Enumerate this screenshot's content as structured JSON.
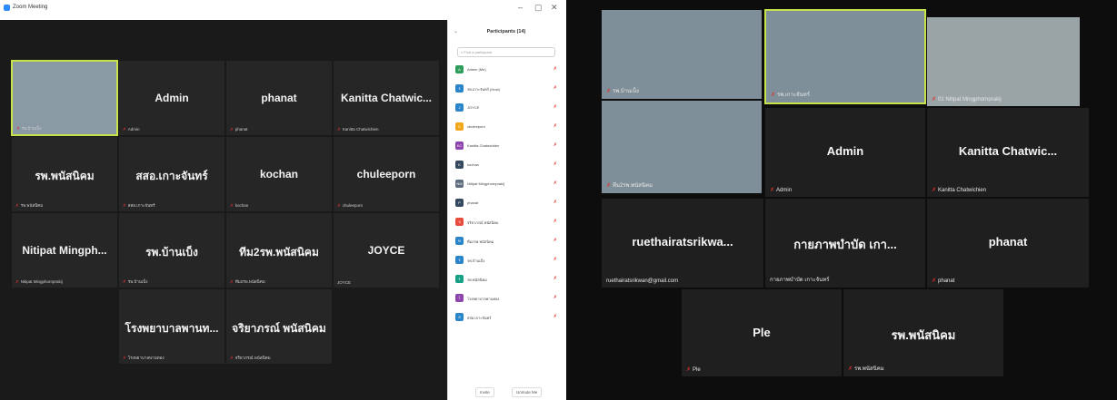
{
  "left_window": {
    "title": "Zoom Meeting",
    "window_controls": [
      "–",
      "▢",
      "✕"
    ],
    "gallery": [
      {
        "name": "",
        "sub": "รพ.บ้านเบ็ง",
        "video": true
      },
      {
        "name": "Admin",
        "sub": "Admin"
      },
      {
        "name": "phanat",
        "sub": "phanat"
      },
      {
        "name": "Kanitta Chatwic...",
        "sub": "Kanitta Chatwichien"
      },
      {
        "name": "รพ.พนัสนิคม",
        "sub": "รพ.พนัสนิคม"
      },
      {
        "name": "สสอ.เกาะจันทร์",
        "sub": "สสอ.เกาะจันทร์"
      },
      {
        "name": "kochan",
        "sub": "kochan"
      },
      {
        "name": "chuleeporn",
        "sub": "chuleeporn"
      },
      {
        "name": "Nitipat Mingph...",
        "sub": "Nitipat Mingphornprakij"
      },
      {
        "name": "รพ.บ้านเบ็ง",
        "sub": "รพ.บ้านเบ็ง"
      },
      {
        "name": "ทีม2รพ.พนัสนิคม",
        "sub": "ทีม2รพ.พนัสนิคม"
      },
      {
        "name": "JOYCE",
        "sub": "JOYCE"
      },
      {
        "name": "โรงพยาบาลพานท...",
        "sub": "โรงพยาบาลพานทอง"
      },
      {
        "name": "จริยาภรณ์ พนัสนิคม",
        "sub": "จริยาภรณ์ พนัสนิคม"
      }
    ],
    "participants_panel": {
      "title": "Participants (14)",
      "search_placeholder": "Find a participant",
      "participants": [
        {
          "initial": "A",
          "name": "Admin (Me)",
          "color": "#2e9d5b"
        },
        {
          "initial": "ร",
          "name": "รพ.เกาะจันทร์ (Host)",
          "color": "#2b86c9"
        },
        {
          "initial": "J",
          "name": "JOYCE",
          "color": "#2b86c9"
        },
        {
          "initial": "C",
          "name": "chuleeporn",
          "color": "#f2a71b"
        },
        {
          "initial": "KC",
          "name": "Kanitta Chatwichien",
          "color": "#8e44ad"
        },
        {
          "initial": "K",
          "name": "kochan",
          "color": "#34495e"
        },
        {
          "initial": "NM",
          "name": "Nitipat Mingphornprakij",
          "color": "#5d6d7e"
        },
        {
          "initial": "P",
          "name": "phanat",
          "color": "#34495e"
        },
        {
          "initial": "จ",
          "name": "จริยาภรณ์ พนัสนิคม",
          "color": "#e74c3c"
        },
        {
          "initial": "ท",
          "name": "ทีม2รพ.พนัสนิคม",
          "color": "#2b86c9"
        },
        {
          "initial": "ร",
          "name": "รพ.บ้านเบ็ง",
          "color": "#2b86c9"
        },
        {
          "initial": "ร",
          "name": "รพ.พนัสนิคม",
          "color": "#16a085"
        },
        {
          "initial": "โ",
          "name": "โรงพยาบาลพานทอง",
          "color": "#8e44ad"
        },
        {
          "initial": "ส",
          "name": "สสอ.เกาะจันทร์",
          "color": "#2b86c9"
        }
      ],
      "invite_label": "Invite",
      "unmute_label": "Unmute Me"
    }
  },
  "right_window": {
    "gallery": [
      {
        "name": "",
        "sub": "รพ.บ้านเบ็ง",
        "video": true
      },
      {
        "name": "",
        "sub": "รพ.เกาะจันทร์",
        "video": true,
        "highlight": true
      },
      {
        "name": "",
        "sub": "01 Nitipat Mingphornprakij",
        "video": true
      },
      {
        "name": "",
        "sub": "ทีม2รพ.พนัสนิคม",
        "video": true
      },
      {
        "name": "Admin",
        "sub": "Admin"
      },
      {
        "name": "Kanitta Chatwic...",
        "sub": "Kanitta Chatwichien"
      },
      {
        "name": "ruethairatsrikwa...",
        "sub": "ruethairatsrikwan@gmail.com"
      },
      {
        "name": "กายภาพบำบัด เกา...",
        "sub": "กายภาพบำบัด เกาะจันทร์"
      },
      {
        "name": "phanat",
        "sub": "phanat"
      },
      {
        "name": "Ple",
        "sub": "Ple"
      },
      {
        "name": "รพ.พนัสนิคม",
        "sub": "รพ.พนัสนิคม"
      }
    ]
  }
}
